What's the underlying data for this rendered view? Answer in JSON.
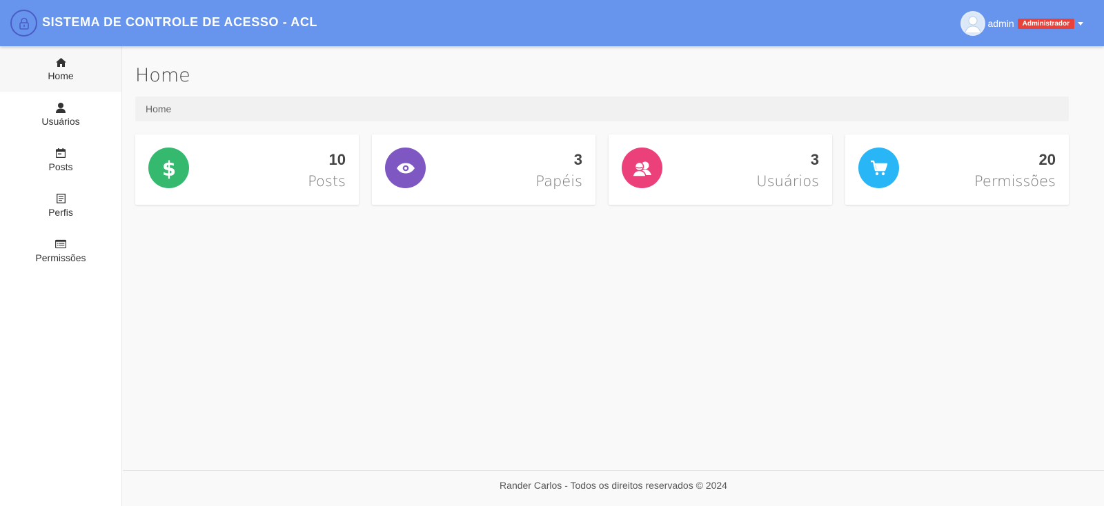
{
  "header": {
    "title": "SISTEMA DE CONTROLE DE ACESSO - ACL",
    "logo_icon": "lock-icon",
    "user": {
      "name": "admin",
      "role": "Administrador"
    },
    "colors": {
      "bar": "#6794ec",
      "role_badge": "#e8423a"
    }
  },
  "sidebar": {
    "items": [
      {
        "label": "Home",
        "icon": "home-icon",
        "active": true
      },
      {
        "label": "Usuários",
        "icon": "user-icon"
      },
      {
        "label": "Posts",
        "icon": "calendar-icon"
      },
      {
        "label": "Perfis",
        "icon": "document-icon"
      },
      {
        "label": "Permissões",
        "icon": "list-icon"
      }
    ]
  },
  "main": {
    "page_title": "Home",
    "breadcrumb": "Home",
    "cards": [
      {
        "count": "10",
        "label": "Posts",
        "icon": "dollar-icon",
        "color": "#34b96e"
      },
      {
        "count": "3",
        "label": "Papéis",
        "icon": "eye-icon",
        "color": "#7e57c2"
      },
      {
        "count": "3",
        "label": "Usuários",
        "icon": "users-icon",
        "color": "#ec407a"
      },
      {
        "count": "20",
        "label": "Permissões",
        "icon": "cart-icon",
        "color": "#29b6f6"
      }
    ]
  },
  "footer": {
    "text": "Rander Carlos - Todos os direitos reservados © 2024"
  }
}
